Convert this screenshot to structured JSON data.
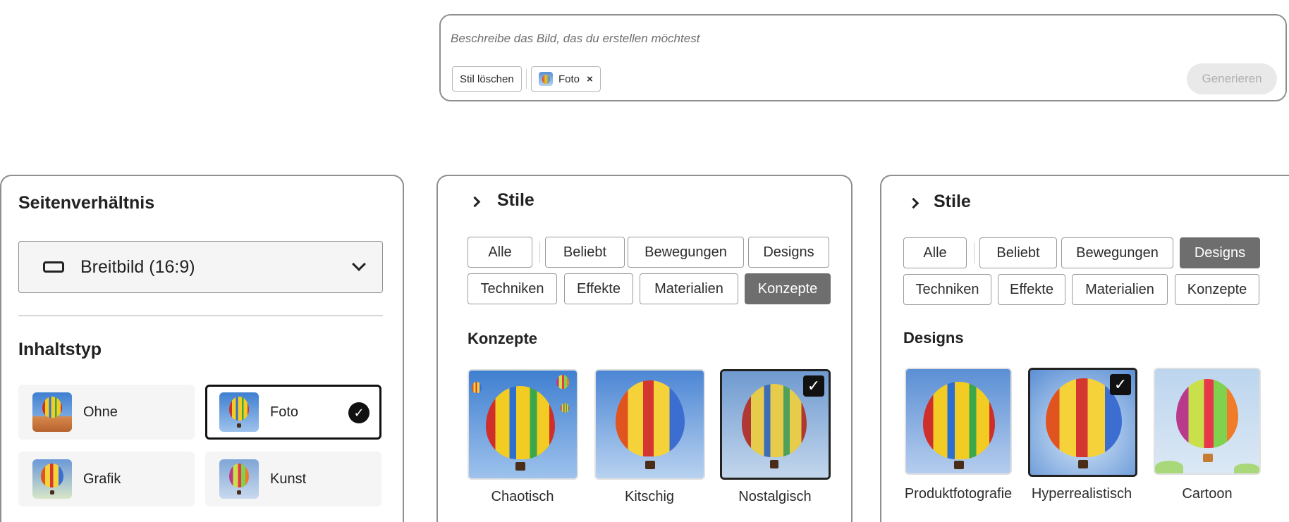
{
  "prompt": {
    "placeholder": "Beschreibe das Bild, das du erstellen möchtest",
    "clear_style_label": "Stil löschen",
    "style_chip_label": "Foto",
    "style_chip_remove": "×",
    "generate_label": "Generieren"
  },
  "settings": {
    "aspect_title": "Seitenverhältnis",
    "aspect_value": "Breitbild (16:9)",
    "content_title": "Inhaltstyp",
    "content_types": [
      {
        "label": "Ohne",
        "selected": false
      },
      {
        "label": "Foto",
        "selected": true
      },
      {
        "label": "Grafik",
        "selected": false
      },
      {
        "label": "Kunst",
        "selected": false
      }
    ]
  },
  "styles_concepts": {
    "title": "Stile",
    "tabs": [
      "Alle",
      "Beliebt",
      "Bewegungen",
      "Designs",
      "Techniken",
      "Effekte",
      "Materialien",
      "Konzepte"
    ],
    "active_tab": "Konzepte",
    "section_title": "Konzepte",
    "tiles": [
      {
        "label": "Chaotisch",
        "selected": false
      },
      {
        "label": "Kitschig",
        "selected": false
      },
      {
        "label": "Nostalgisch",
        "selected": true
      }
    ]
  },
  "styles_designs": {
    "title": "Stile",
    "tabs": [
      "Alle",
      "Beliebt",
      "Bewegungen",
      "Designs",
      "Techniken",
      "Effekte",
      "Materialien",
      "Konzepte"
    ],
    "active_tab": "Designs",
    "section_title": "Designs",
    "tiles": [
      {
        "label": "Produktfotografie",
        "selected": false
      },
      {
        "label": "Hyperrealistisch",
        "selected": true
      },
      {
        "label": "Cartoon",
        "selected": false
      }
    ]
  },
  "icons": {
    "check": "✓",
    "ratio": "widescreen-ratio-icon",
    "dropdown": "chevron-down-icon",
    "section": "chevron-right-icon"
  },
  "colors": {
    "active_tab": "#6e6e6e",
    "border": "#8f8f8f",
    "generate_disabled_bg": "#e9e9e9",
    "generate_disabled_text": "#b0b0b0"
  }
}
